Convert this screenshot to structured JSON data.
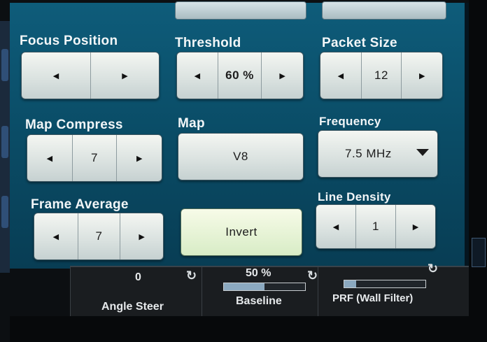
{
  "controls": {
    "focus_position": {
      "label": "Focus Position"
    },
    "threshold": {
      "label": "Threshold",
      "value": "60 %"
    },
    "packet_size": {
      "label": "Packet Size",
      "value": "12"
    },
    "map_compress": {
      "label": "Map Compress",
      "value": "7"
    },
    "map": {
      "label": "Map",
      "value": "V8"
    },
    "frequency": {
      "label": "Frequency",
      "value": "7.5 MHz"
    },
    "frame_average": {
      "label": "Frame Average",
      "value": "7"
    },
    "invert": {
      "label": "Invert"
    },
    "line_density": {
      "label": "Line Density",
      "value": "1"
    }
  },
  "footer": {
    "angle_steer": {
      "label": "Angle Steer",
      "value": "0"
    },
    "baseline": {
      "label": "Baseline",
      "value": "50 %",
      "level": 0.5
    },
    "prf": {
      "label": "PRF (Wall Filter)",
      "level": 0.15
    }
  },
  "icons": {
    "left_arrow": "◀",
    "right_arrow": "▶",
    "reset": "↻"
  },
  "colors": {
    "panel": "#0a4c66",
    "button": "#d9e1df",
    "invert_active": "#d8ecc6"
  }
}
